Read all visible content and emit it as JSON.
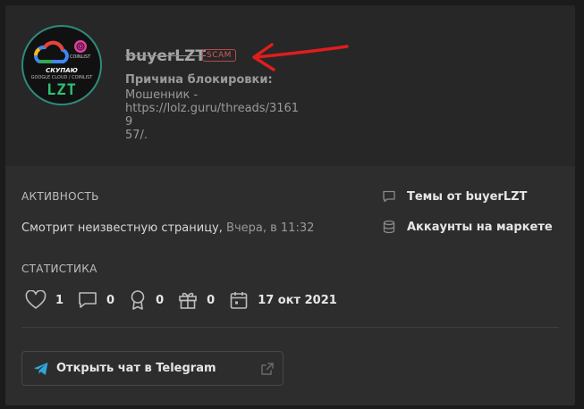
{
  "profile": {
    "username": "buyerLZT",
    "badge": "SCAM",
    "ban_title": "Причина блокировки:",
    "ban_reason": "Мошенник - https://lolz.guru/threads/3161957/.",
    "avatar": {
      "text_top": "COINLIST",
      "text_mid": "СКУПАЮ",
      "text_sub": "GOOGLE CLOUD / COINLIST",
      "text_logo": "LZT"
    }
  },
  "activity": {
    "label": "АКТИВНОСТЬ",
    "status": "Смотрит неизвестную страницу,",
    "time": "Вчера, в 11:32"
  },
  "links": {
    "threads": "Темы от buyerLZT",
    "market": "Аккаунты на маркете"
  },
  "stats": {
    "label": "СТАТИСТИКА",
    "likes": "1",
    "messages": "0",
    "trophies": "0",
    "gifts": "0",
    "registered": "17 окт 2021"
  },
  "telegram": {
    "label": "Открыть чат в Telegram"
  },
  "colors": {
    "scam": "#d65a5a",
    "arrow": "#e01d1d",
    "telegram": "#2ea6da",
    "avatar_border": "#2e8a7c"
  }
}
